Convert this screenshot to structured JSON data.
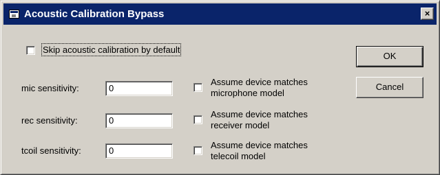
{
  "window": {
    "title": "Acoustic Calibration Bypass",
    "close_glyph": "×"
  },
  "skip_default": {
    "label": "Skip acoustic calibration by default",
    "checked": false
  },
  "sensitivities": [
    {
      "label": "mic sensitivity:",
      "value": "0",
      "assume_line1": "Assume device matches",
      "assume_line2": "microphone model",
      "assume_checked": false
    },
    {
      "label": "rec sensitivity:",
      "value": "0",
      "assume_line1": "Assume device matches",
      "assume_line2": "receiver model",
      "assume_checked": false
    },
    {
      "label": "tcoil sensitivity:",
      "value": "0",
      "assume_line1": "Assume device matches",
      "assume_line2": "telecoil model",
      "assume_checked": false
    }
  ],
  "buttons": {
    "ok": "OK",
    "cancel": "Cancel"
  }
}
